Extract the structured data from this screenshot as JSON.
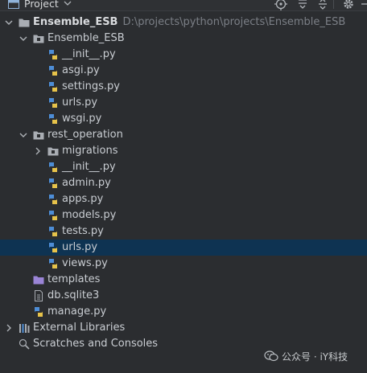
{
  "header": {
    "title": "Project",
    "colors": {
      "background": "#2f3134",
      "text": "#d6d8da"
    },
    "icons": [
      "project-window-icon",
      "chevron-down-icon",
      "locate-target-icon",
      "expand-all-icon",
      "collapse-all-icon",
      "gear-icon"
    ]
  },
  "tree": {
    "rows": [
      {
        "label": "Ensemble_ESB",
        "path": "D:\\projects\\python\\projects\\Ensemble_ESB",
        "type": "root-folder",
        "expanded": true
      },
      {
        "label": "Ensemble_ESB",
        "type": "package-folder",
        "expanded": true
      },
      {
        "label": "__init__.py",
        "type": "python-file"
      },
      {
        "label": "asgi.py",
        "type": "python-file"
      },
      {
        "label": "settings.py",
        "type": "python-file"
      },
      {
        "label": "urls.py",
        "type": "python-file"
      },
      {
        "label": "wsgi.py",
        "type": "python-file"
      },
      {
        "label": "rest_operation",
        "type": "package-folder",
        "expanded": true
      },
      {
        "label": "migrations",
        "type": "package-folder",
        "expanded": false
      },
      {
        "label": "__init__.py",
        "type": "python-file"
      },
      {
        "label": "admin.py",
        "type": "python-file"
      },
      {
        "label": "apps.py",
        "type": "python-file"
      },
      {
        "label": "models.py",
        "type": "python-file"
      },
      {
        "label": "tests.py",
        "type": "python-file"
      },
      {
        "label": "urls.py",
        "type": "python-file",
        "selected": true
      },
      {
        "label": "views.py",
        "type": "python-file"
      },
      {
        "label": "templates",
        "type": "templates-folder"
      },
      {
        "label": "db.sqlite3",
        "type": "database-file"
      },
      {
        "label": "manage.py",
        "type": "python-file"
      },
      {
        "label": "External Libraries",
        "type": "libraries",
        "expanded": false
      },
      {
        "label": "Scratches and Consoles",
        "type": "scratches"
      }
    ],
    "colors": {
      "selected_row": "#0e3352",
      "text": "#c9cdd2",
      "path": "#7b7f86"
    }
  },
  "watermark": {
    "text": "公众号 · iY科技"
  }
}
